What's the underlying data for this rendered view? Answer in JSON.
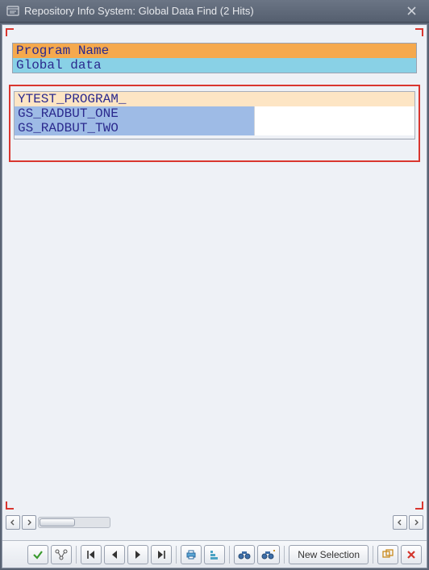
{
  "window": {
    "title": "Repository Info System: Global Data Find (2 Hits)"
  },
  "header": {
    "row1": "Program Name",
    "row2": "Global data"
  },
  "result": {
    "program": "YTEST_PROGRAM_",
    "rows": [
      {
        "name": "GS_RADBUT_ONE"
      },
      {
        "name": "GS_RADBUT_TWO"
      }
    ]
  },
  "toolbar": {
    "new_selection": "New Selection"
  }
}
